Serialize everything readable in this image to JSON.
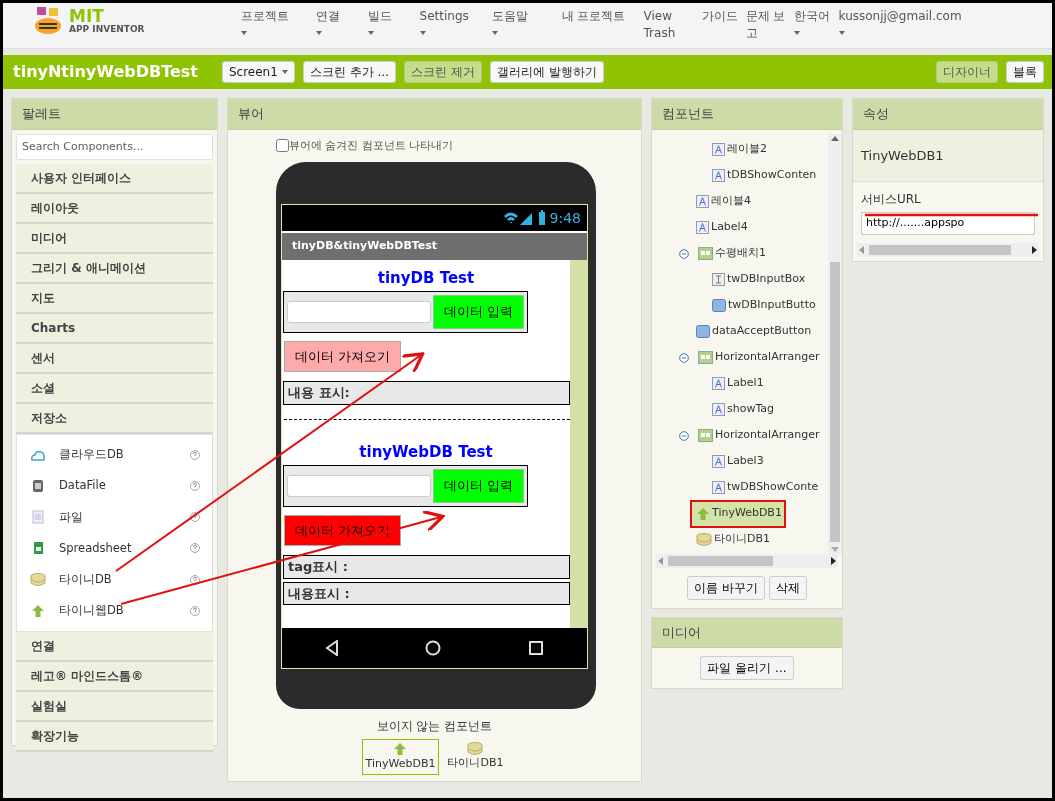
{
  "nav": {
    "logo": {
      "title": "MIT",
      "subtitle": "APP INVENTOR"
    },
    "menu": [
      {
        "label": "프로젝트",
        "dropdown": true
      },
      {
        "label": "연결",
        "dropdown": true
      },
      {
        "label": "빌드",
        "dropdown": true
      },
      {
        "label": "Settings",
        "dropdown": true
      },
      {
        "label": "도움말",
        "dropdown": true
      },
      {
        "label": "내 프로젝트",
        "dropdown": false
      },
      {
        "label": "View Trash",
        "dropdown": false
      },
      {
        "label": "가이드",
        "dropdown": false
      },
      {
        "label": "문제 보고",
        "dropdown": false
      },
      {
        "label": "한국어",
        "dropdown": true
      },
      {
        "label": "kussonjj@gmail.com",
        "dropdown": true
      }
    ]
  },
  "project_bar": {
    "title": "tinyNtinyWebDBTest",
    "buttons": [
      {
        "label": "Screen1",
        "dropdown": true,
        "disabled": false
      },
      {
        "label": "스크린 추가 ...",
        "dropdown": false,
        "disabled": false
      },
      {
        "label": "스크린 제거",
        "dropdown": false,
        "disabled": true
      },
      {
        "label": "갤러리에 발행하기",
        "dropdown": false,
        "disabled": false
      }
    ],
    "views": [
      {
        "label": "디자이너",
        "selected": true
      },
      {
        "label": "블록",
        "selected": false
      }
    ]
  },
  "palette": {
    "title": "팔레트",
    "search_placeholder": "Search Components...",
    "categories": [
      {
        "label": "사용자 인터페이스"
      },
      {
        "label": "레이아웃"
      },
      {
        "label": "미디어"
      },
      {
        "label": "그리기 & 애니메이션"
      },
      {
        "label": "지도"
      },
      {
        "label": "Charts"
      },
      {
        "label": "센서"
      },
      {
        "label": "소셜"
      },
      {
        "label": "저장소",
        "items": [
          {
            "label": "클라우드DB",
            "kind": "cloud"
          },
          {
            "label": "DataFile",
            "kind": "datafile"
          },
          {
            "label": "파일",
            "kind": "file"
          },
          {
            "label": "Spreadsheet",
            "kind": "sheet"
          },
          {
            "label": "타이니DB",
            "kind": "db"
          },
          {
            "label": "타이니웹DB",
            "kind": "webdb"
          }
        ]
      },
      {
        "label": "연결"
      },
      {
        "label": "레고® 마인드스톰®"
      },
      {
        "label": "실험실"
      },
      {
        "label": "확장기능"
      }
    ]
  },
  "viewer": {
    "title": "뷰어",
    "hidden_toggle": {
      "label": "뷰어에 숨겨진 컴포넌트 나타내기",
      "checked": false
    },
    "phone": {
      "time": "9:48",
      "app_title": "tinyDB&tinyWebDBTest",
      "blocks": [
        {
          "kind": "heading",
          "text": "tinyDB Test"
        },
        {
          "kind": "input_row",
          "button": "데이터 입력",
          "color": "#00ff00"
        },
        {
          "kind": "button",
          "text": "데이터 가져오기",
          "color": "#ffaaaa"
        },
        {
          "kind": "label",
          "text": "내용 표시:"
        },
        {
          "kind": "divider"
        },
        {
          "kind": "heading",
          "text": "tinyWebDB Test"
        },
        {
          "kind": "input_row",
          "button": "데이터 입력",
          "color": "#00ff00"
        },
        {
          "kind": "button",
          "text": "데이터 가져오기",
          "color": "#ff0000"
        },
        {
          "kind": "label",
          "text": "tag표시 :"
        },
        {
          "kind": "label",
          "text": "내용표시 :"
        }
      ]
    },
    "nonvisible": {
      "title": "보이지 않는 컴포넌트",
      "items": [
        {
          "label": "TinyWebDB1",
          "kind": "webdb",
          "selected": true
        },
        {
          "label": "타이니DB1",
          "kind": "db",
          "selected": false
        }
      ]
    }
  },
  "components": {
    "title": "컴포넌트",
    "tree": [
      {
        "kind": "continued",
        "children": [
          {
            "label": "레이블2",
            "kind": "label",
            "selected": false
          },
          {
            "label": "tDBShowConten",
            "kind": "label",
            "selected": false
          }
        ]
      },
      {
        "label": "레이블4",
        "kind": "label",
        "selected": false
      },
      {
        "label": "Label4",
        "kind": "label",
        "selected": false
      },
      {
        "label": "수평배치1",
        "kind": "arrangement",
        "expanded": true,
        "selected": false,
        "children": [
          {
            "label": "twDBInputBox",
            "kind": "textbox",
            "selected": false
          },
          {
            "label": "twDBInputButto",
            "kind": "button",
            "selected": false
          }
        ]
      },
      {
        "label": "dataAcceptButton",
        "kind": "button",
        "selected": false
      },
      {
        "label": "HorizontalArranger",
        "kind": "arrangement",
        "expanded": true,
        "selected": false,
        "children": [
          {
            "label": "Label1",
            "kind": "label",
            "selected": false
          },
          {
            "label": "showTag",
            "kind": "label",
            "selected": false
          }
        ]
      },
      {
        "label": "HorizontalArranger",
        "kind": "arrangement",
        "expanded": true,
        "selected": false,
        "children": [
          {
            "label": "Label3",
            "kind": "label",
            "selected": false
          },
          {
            "label": "twDBShowConte",
            "kind": "label",
            "selected": false
          }
        ]
      },
      {
        "label": "TinyWebDB1",
        "kind": "webdb",
        "selected": true
      },
      {
        "label": "타이니DB1",
        "kind": "db",
        "selected": false
      }
    ],
    "buttons": [
      "이름 바꾸기",
      "삭제"
    ]
  },
  "media": {
    "title": "미디어",
    "button": "파일 올리기 ..."
  },
  "properties": {
    "title": "속성",
    "component": "TinyWebDB1",
    "property": "서비스URL",
    "value": "http://.......appspo"
  }
}
